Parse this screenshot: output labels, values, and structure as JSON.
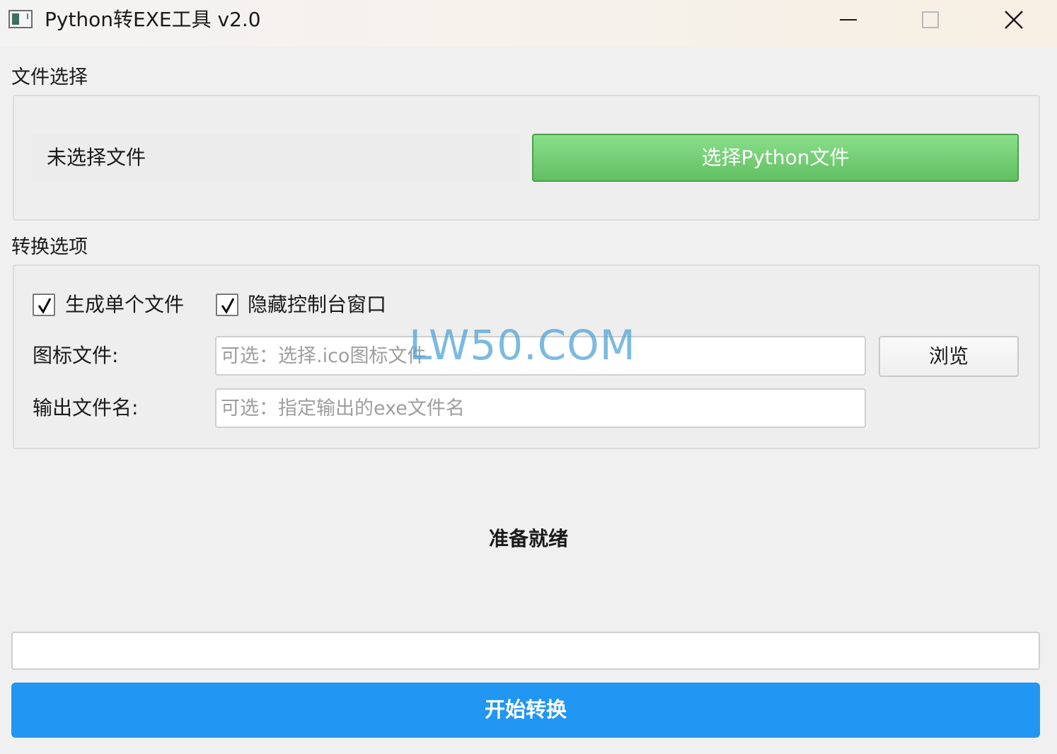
{
  "window": {
    "title": "Python转EXE工具 v2.0",
    "icon": "python-app-icon",
    "controls": [
      "minimize-icon",
      "maximize-icon",
      "close-icon"
    ]
  },
  "file_section": {
    "title": "文件选择",
    "selected_file": "未选择文件",
    "choose_button": "选择Python文件"
  },
  "options_section": {
    "title": "转换选项",
    "onefile": {
      "label": "生成单个文件",
      "checked": true
    },
    "noconsole": {
      "label": "隐藏控制台窗口",
      "checked": true
    },
    "icon_file": {
      "label": "图标文件:",
      "value": "",
      "placeholder": "可选：选择.ico图标文件"
    },
    "browse_button": "浏览",
    "output_name": {
      "label": "输出文件名:",
      "value": "",
      "placeholder": "可选：指定输出的exe文件名"
    }
  },
  "watermark": "LW50.COM",
  "status": "准备就绪",
  "progress": 0,
  "start_button": "开始转换",
  "colors": {
    "choose_button": "#6ecf6e",
    "start_button": "#2196f3",
    "watermark": "#4aa0d6"
  }
}
